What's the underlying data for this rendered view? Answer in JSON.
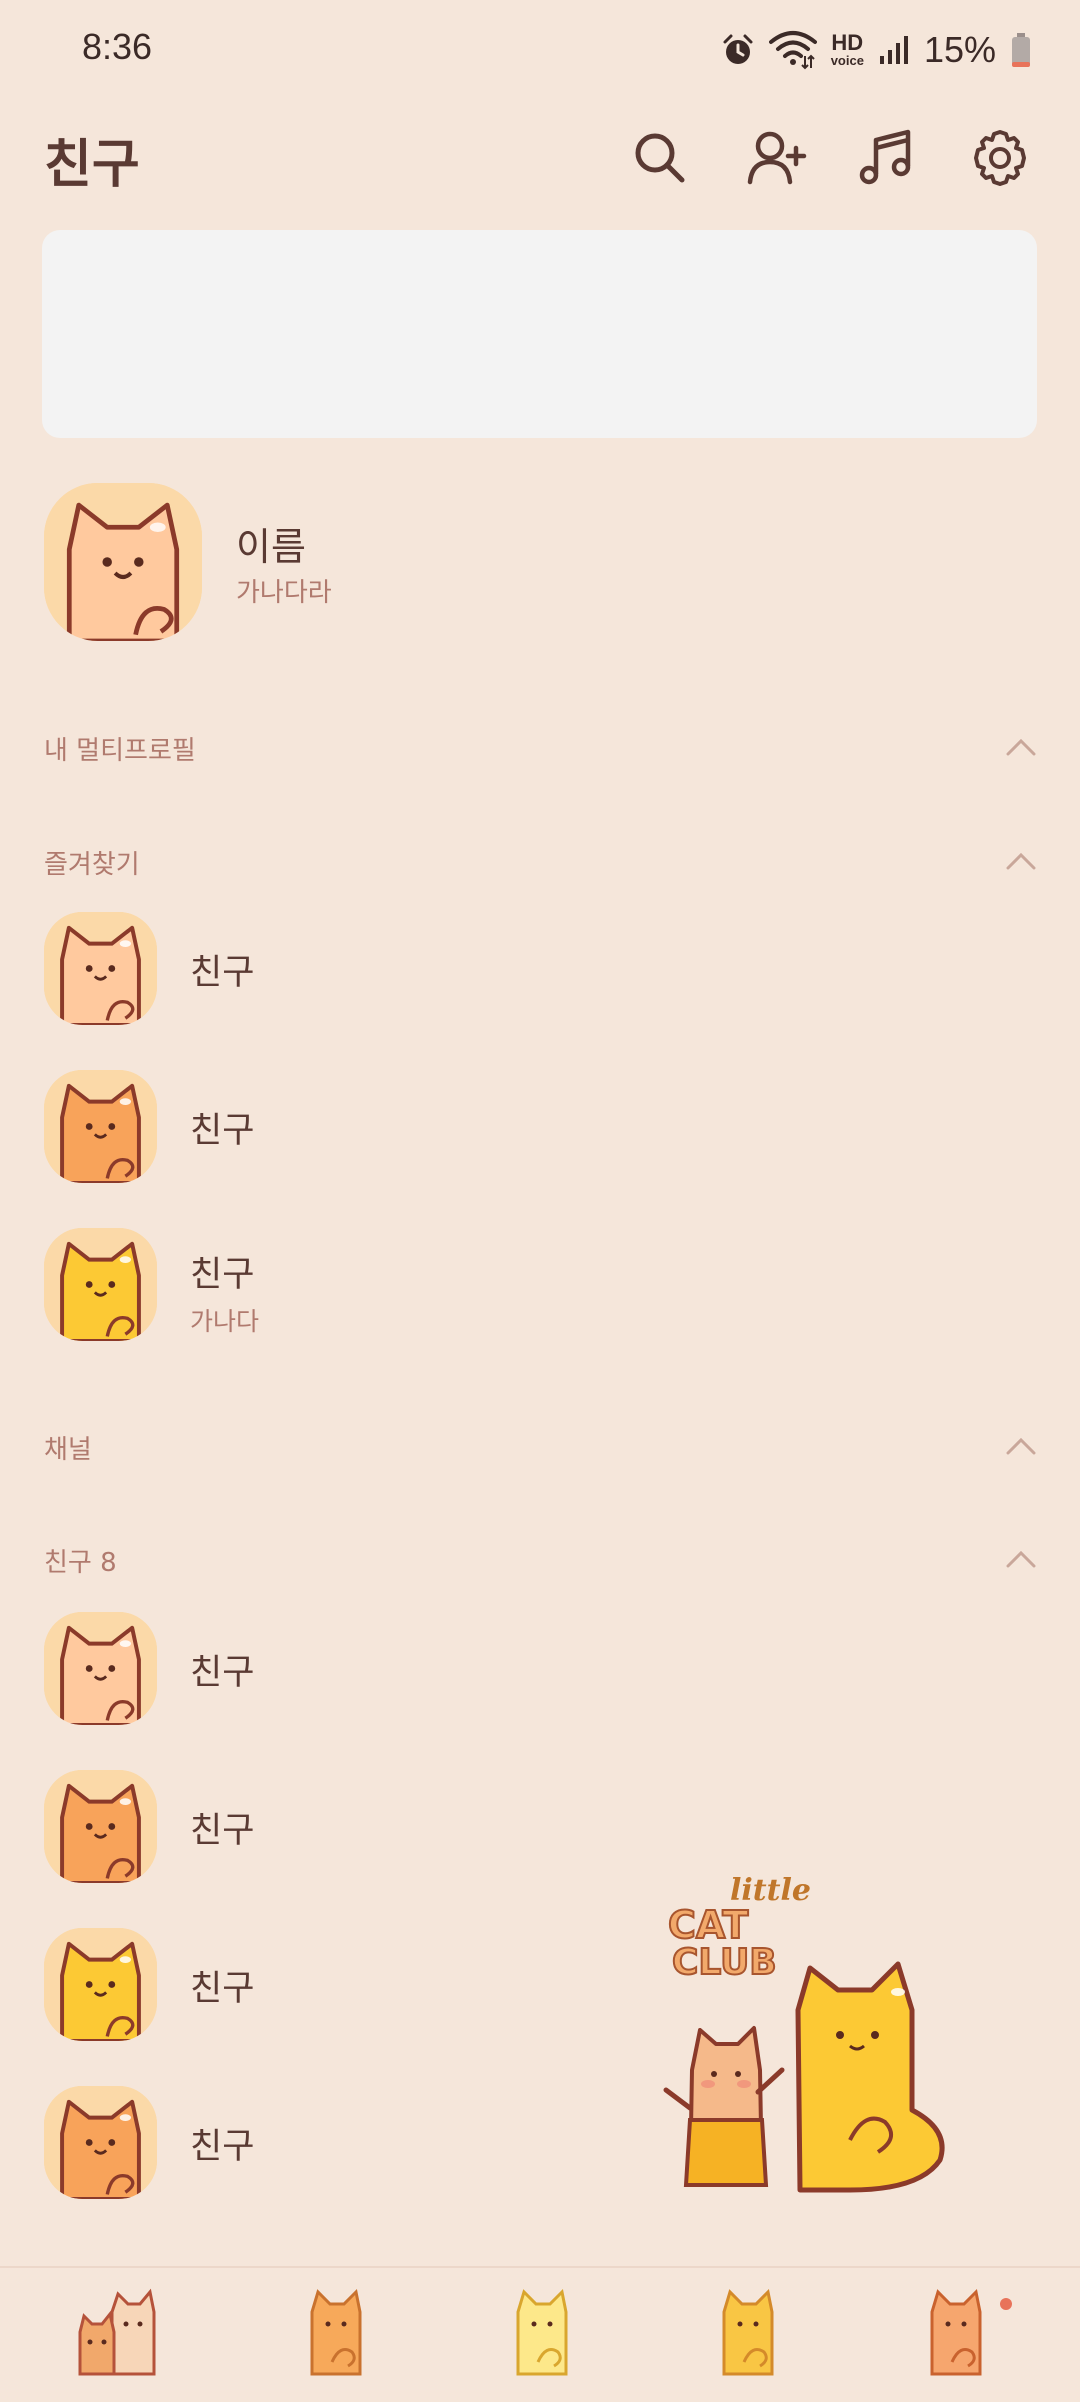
{
  "status_bar": {
    "time": "8:36",
    "hd_label": "HD",
    "voice_label": "voice",
    "battery_percent": "15%",
    "battery_level": 0.15,
    "icons": [
      "alarm-icon",
      "wifi-icon",
      "hd-voice-icon",
      "signal-icon",
      "battery-icon"
    ]
  },
  "header": {
    "title": "친구",
    "actions": [
      "search-icon",
      "add-friend-icon",
      "music-icon",
      "settings-icon"
    ]
  },
  "my_profile": {
    "name": "이름",
    "status": "가나다라"
  },
  "sections": {
    "multi_profile": {
      "label": "내 멀티프로필"
    },
    "favorites": {
      "label": "즐겨찾기"
    },
    "channels": {
      "label": "채널"
    },
    "friends": {
      "label": "친구 8"
    }
  },
  "favorites": [
    {
      "name": "친구",
      "status": "",
      "color": "#ffc99e"
    },
    {
      "name": "친구",
      "status": "",
      "color": "#f8a35a"
    },
    {
      "name": "친구",
      "status": "가나다",
      "color": "#fcc934"
    }
  ],
  "friends": [
    {
      "name": "친구",
      "color": "#ffc99e"
    },
    {
      "name": "친구",
      "color": "#f8a35a"
    },
    {
      "name": "친구",
      "color": "#fcc934"
    },
    {
      "name": "친구",
      "color": "#f8a35a"
    }
  ],
  "artwork": {
    "line1": "little",
    "line2": "CAT",
    "line3": "CLUB"
  },
  "tab_bar": {
    "tabs": [
      "friends-tab",
      "chats-tab",
      "openchat-tab",
      "shopping-tab",
      "more-tab"
    ],
    "notification_dot_on": "more-tab"
  },
  "colors": {
    "background": "#f5e6da",
    "title": "#5a3a33",
    "secondary": "#b07a6e",
    "cat_outline": "#8b3a2a"
  }
}
